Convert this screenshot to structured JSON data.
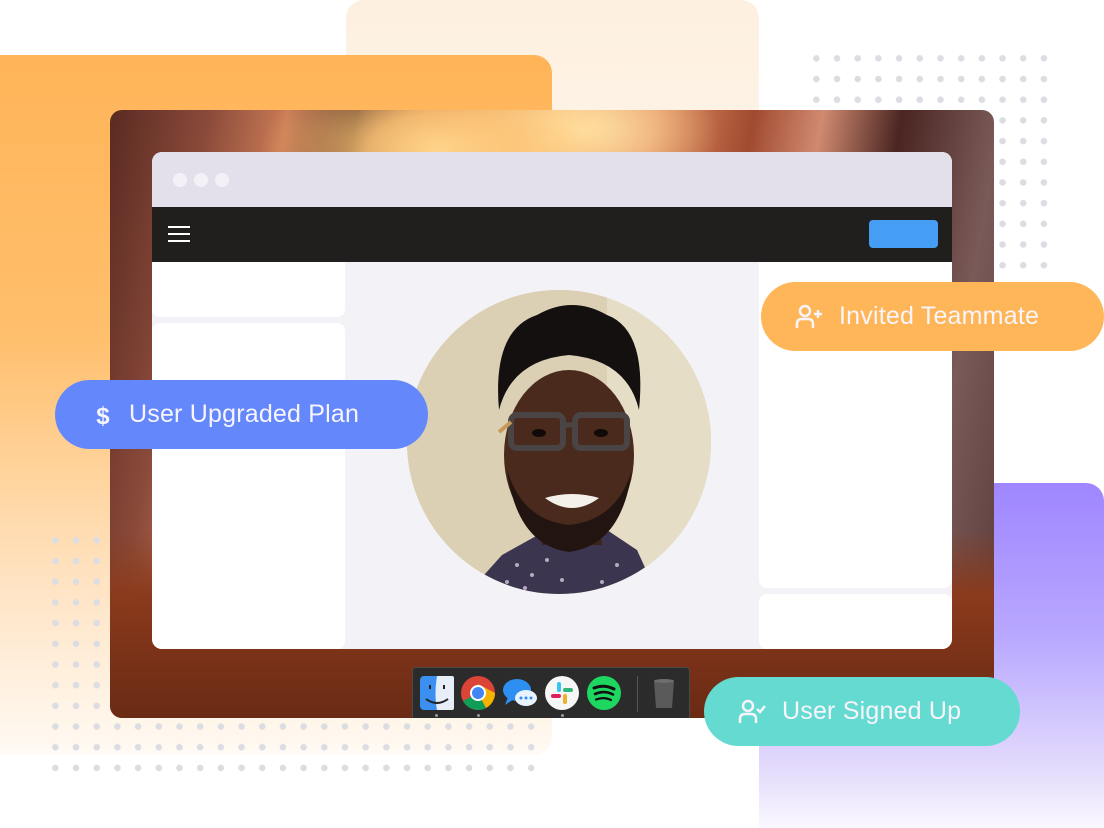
{
  "browser_window": {
    "traffic_lights": [
      "close",
      "minimize",
      "maximize"
    ],
    "navbar": {
      "menu_icon": "hamburger-icon",
      "action_button_label": "",
      "action_button_color": "#469ef4"
    }
  },
  "profile": {
    "avatar_alt": "Smiling man with glasses"
  },
  "dock": {
    "apps": [
      {
        "name": "Finder",
        "icon": "finder-icon",
        "running": true
      },
      {
        "name": "Chrome",
        "icon": "chrome-icon",
        "running": true
      },
      {
        "name": "Messages",
        "icon": "messages-icon",
        "running": false
      },
      {
        "name": "Slack",
        "icon": "slack-icon",
        "running": true
      },
      {
        "name": "Spotify",
        "icon": "spotify-icon",
        "running": false
      },
      {
        "name": "Trash",
        "icon": "trash-icon",
        "running": false
      }
    ]
  },
  "events": [
    {
      "label": "User Upgraded Plan",
      "icon": "dollar-icon",
      "color": "#6488fc"
    },
    {
      "label": "Invited Teammate",
      "icon": "user-plus-icon",
      "color": "#ffb658"
    },
    {
      "label": "User Signed Up",
      "icon": "user-check-icon",
      "color": "#64dad1"
    }
  ]
}
